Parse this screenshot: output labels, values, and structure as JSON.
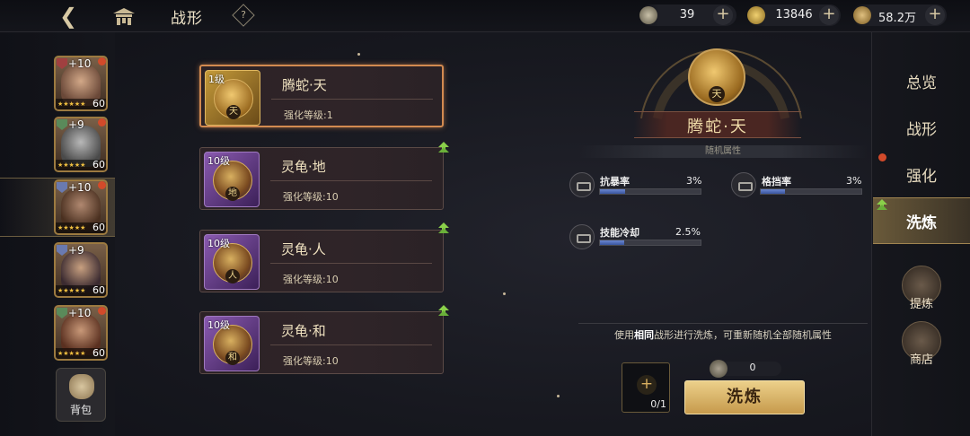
{
  "header": {
    "title": "战形",
    "help": "?"
  },
  "resources": [
    {
      "name": "ticket",
      "value": "39"
    },
    {
      "name": "gold",
      "value": "13846"
    },
    {
      "name": "coin",
      "value": "58.2万"
    }
  ],
  "heroes": [
    {
      "plus": "+10",
      "level": "60",
      "stars": "★★★★★"
    },
    {
      "plus": "+9",
      "level": "60",
      "stars": "★★★★★"
    },
    {
      "plus": "+10",
      "level": "60",
      "stars": "★★★★★"
    },
    {
      "plus": "+9",
      "level": "60",
      "stars": "★★★★★"
    },
    {
      "plus": "+10",
      "level": "60",
      "stars": "★★★★★"
    }
  ],
  "bag_label": "背包",
  "formations": [
    {
      "level": "1级",
      "name": "腾蛇·天",
      "char": "天",
      "enhance": "强化等级:1"
    },
    {
      "level": "10级",
      "name": "灵龟·地",
      "char": "地",
      "enhance": "强化等级:10"
    },
    {
      "level": "10级",
      "name": "灵龟·人",
      "char": "人",
      "enhance": "强化等级:10"
    },
    {
      "level": "10级",
      "name": "灵龟·和",
      "char": "和",
      "enhance": "强化等级:10"
    }
  ],
  "detail": {
    "name": "腾蛇·天",
    "char": "天",
    "random_title": "随机属性",
    "attrs": [
      {
        "name": "抗暴率",
        "value": "3%",
        "fill": 0.3
      },
      {
        "name": "格挡率",
        "value": "3%",
        "fill": 0.25
      },
      {
        "name": "技能冷却",
        "value": "2.5%",
        "fill": 0.25
      }
    ],
    "hint_pre": "使用",
    "hint_bold": "相同",
    "hint_post": "战形进行洗炼，可重新随机全部随机属性",
    "slot_count": "0/1",
    "cost": "0",
    "wash_button": "洗炼"
  },
  "tabs": [
    "总览",
    "战形",
    "强化",
    "洗炼"
  ],
  "side_buttons": [
    "提炼",
    "商店"
  ],
  "colors": {
    "accent_gold": "#c69a4c",
    "selected_border": "#d28a50",
    "red_dot": "#d24a2a"
  }
}
